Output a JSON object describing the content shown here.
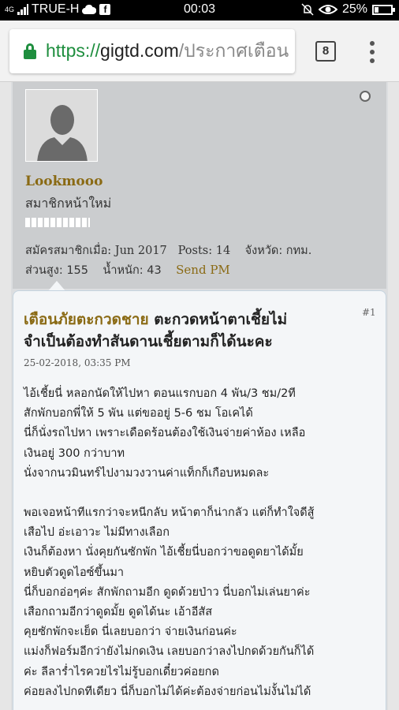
{
  "status_bar": {
    "signal_label": "4G",
    "carrier": "TRUE-H",
    "time": "00:03",
    "battery_percent": "25%",
    "battery_level": 0.25,
    "icons": [
      "signal-icon",
      "cloud-icon",
      "facebook-icon",
      "mute-bell-icon",
      "eye-icon",
      "battery-icon"
    ]
  },
  "browser": {
    "url_scheme": "https://",
    "url_host": "gigtd.com",
    "url_path": "/ประกาศเตือน",
    "tab_count": "8",
    "accent_color": "#1e8e3e"
  },
  "profile": {
    "username": "Lookmooo",
    "rank": "สมาชิกหน้าใหม่",
    "joined": "สมัครสมาชิกเมื่อ: Jun 2017",
    "posts": "Posts: 14",
    "province": "จังหวัด: กทม.",
    "height": "ส่วนสูง: 155",
    "weight": "น้ำหนัก: 43",
    "send_pm": "Send PM",
    "name_color": "#8a6a14"
  },
  "post": {
    "number": "#1",
    "title_prefix": "เตือนภัยตะกวดชาย",
    "title_line1": " ตะกวดหน้าตาเชี้ยไม่",
    "title_line2": "จำเป็นต้องทำสันดานเชี้ยตามก็ได้นะคะ",
    "date": "25-02-2018, 03:35 PM",
    "paragraphs": [
      [
        "ไอ้เชี้ยนี่ หลอกนัดให้ไปหา ตอนแรกบอก 4 พัน/3 ชม/2ที",
        "สักพักบอกพี่ให้ 5 พัน แต่ขออยู่ 5-6 ชม โอเคได้",
        "นี่ก็นั่งรถไปหา เพราะเดือดร้อนต้องใช้เงินจ่ายค่าห้อง เหลือ",
        "เงินอยู่ 300 กว่าบาท",
        "นั่งจากนวมินทร์ไปงามวงวานค่าแท็กก็เกือบหมดละ"
      ],
      [
        "พอเจอหน้าทีแรกว่าจะหนีกลับ หน้าตาก็น่ากลัว แต่ก็ทำใจดีสู้",
        "เสือไป อ่ะเอาวะ ไม่มีทางเลือก",
        "เงินก็ต้องหา นั่งคุยกันซักพัก ไอ้เชี้ยนี่บอกว่าขอดูดยาได้มั้ย",
        "หยิบตัวดูดไอซ์ขึ้นมา",
        "นี่ก็บอกอ่อๆค่ะ สักพักถามอีก ดูดด้วยป่าว นี่บอกไม่เล่นยาค่ะ",
        "เสือกถามอีกว่าดูดมั้ย ดูดได้นะ เอ้าอีสัส",
        "คุยซักพักจะเย็ด นี่เลยบอกว่า จ่ายเงินก่อนค่ะ",
        "แม่งก็ฟอร์มอีกว่ายังไม่กดเงิน เลยบอกว่าลงไปกดด้วยกันก็ได้",
        "ค่ะ ลีลาร่ำไรควยไรไม่รู้บอกเดี๋ยวค่อยกด",
        "ค่อยลงไปกดทีเดียว นี่ก็บอกไม่ได้ค่ะต้องจ่ายก่อนไม่งั้นไม่ได้"
      ]
    ]
  }
}
